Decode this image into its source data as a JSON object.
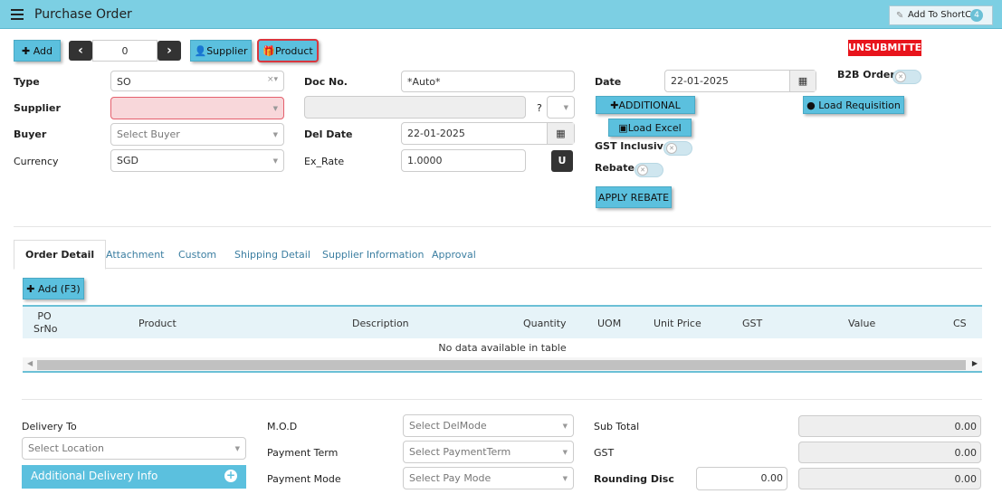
{
  "header": {
    "title": "Purchase Order",
    "shortcut_label": "Add To ShortCut",
    "shortcut_count": "4"
  },
  "toolbar": {
    "add_label": "Add",
    "page_value": "0",
    "supplier_label": "Supplier",
    "product_label": "Product",
    "status": "UNSUBMITTED"
  },
  "form": {
    "type_label": "Type",
    "type_value": "SO",
    "supplier_label": "Supplier",
    "buyer_label": "Buyer",
    "buyer_placeholder": "Select Buyer",
    "currency_label": "Currency",
    "currency_value": "SGD",
    "doc_no_label": "Doc No.",
    "doc_no_value": "*Auto*",
    "question": "?",
    "del_date_label": "Del Date",
    "del_date_value": "22-01-2025",
    "ex_rate_label": "Ex_Rate",
    "ex_rate_value": "1.0000",
    "u_label": "U",
    "date_label": "Date",
    "date_value": "22-01-2025",
    "b2b_label": "B2B Order",
    "additional_label": "ADDITIONAL",
    "load_requisition_label": "Load Requisition",
    "load_excel_label": "Load Excel",
    "gst_inclusive_label": "GST Inclusive",
    "rebate_label": "Rebate",
    "apply_rebate_label": "APPLY REBATE"
  },
  "tabs": [
    "Order Detail",
    "Attachment",
    "Custom",
    "Shipping Detail",
    "Supplier Information",
    "Approval"
  ],
  "grid": {
    "add_label": "Add (F3)",
    "columns": [
      "PO SrNo",
      "Product",
      "Description",
      "Quantity",
      "UOM",
      "Unit Price",
      "GST",
      "Value",
      "CS"
    ],
    "po_line1": "PO",
    "po_line2": "SrNo",
    "empty_text": "No data available in table"
  },
  "footer": {
    "delivery_to_label": "Delivery To",
    "location_placeholder": "Select Location",
    "additional_delivery_label": "Additional Delivery Info",
    "mod_label": "M.O.D",
    "mod_placeholder": "Select DelMode",
    "payment_term_label": "Payment Term",
    "payment_term_placeholder": "Select PaymentTerm",
    "payment_mode_label": "Payment Mode",
    "payment_mode_placeholder": "Select Pay Mode",
    "subtotal_label": "Sub Total",
    "subtotal_value": "0.00",
    "gst_label": "GST",
    "gst_value": "0.00",
    "rounding_label": "Rounding Disc",
    "rounding_value": "0.00",
    "rounding_total": "0.00"
  },
  "colors": {
    "accent": "#5bc0de",
    "header": "#7ccfe3",
    "status": "#e8141c"
  }
}
